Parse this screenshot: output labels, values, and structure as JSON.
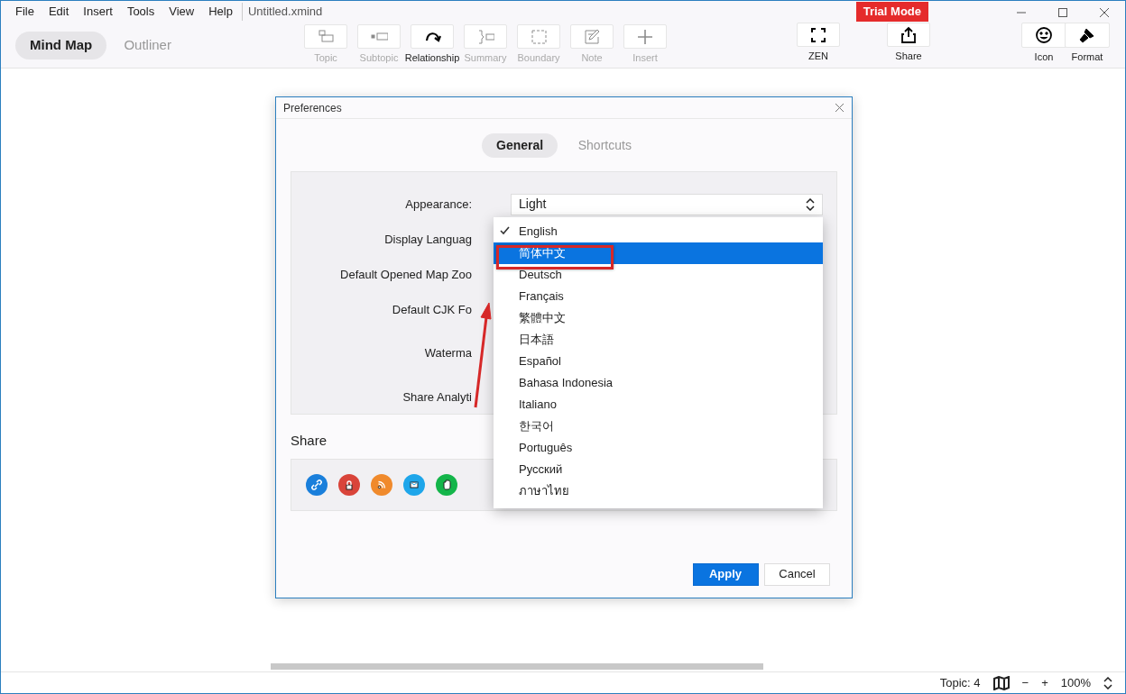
{
  "menu": [
    "File",
    "Edit",
    "Insert",
    "Tools",
    "View",
    "Help"
  ],
  "document_title": "Untitled.xmind",
  "trial_badge": "Trial Mode",
  "view_tabs": [
    {
      "label": "Mind Map",
      "selected": true
    },
    {
      "label": "Outliner",
      "selected": false
    }
  ],
  "tools": [
    {
      "kind": "topic",
      "label": "Topic",
      "disabled": true
    },
    {
      "kind": "subtopic",
      "label": "Subtopic",
      "disabled": true
    },
    {
      "kind": "relationship",
      "label": "Relationship",
      "disabled": false
    },
    {
      "kind": "summary",
      "label": "Summary",
      "disabled": true
    },
    {
      "kind": "boundary",
      "label": "Boundary",
      "disabled": true
    },
    {
      "kind": "note",
      "label": "Note",
      "disabled": true
    },
    {
      "kind": "insert",
      "label": "Insert",
      "disabled": true
    }
  ],
  "zen": {
    "label": "ZEN"
  },
  "share_button": {
    "label": "Share"
  },
  "panel_tools": [
    {
      "kind": "icon",
      "label": "Icon"
    },
    {
      "kind": "format",
      "label": "Format"
    }
  ],
  "dialog": {
    "title": "Preferences",
    "tabs": [
      {
        "label": "General",
        "selected": true
      },
      {
        "label": "Shortcuts",
        "selected": false
      }
    ],
    "settings": [
      {
        "label": "Appearance:",
        "value": "Light"
      },
      {
        "label": "Display Languag"
      },
      {
        "label": "Default Opened Map Zoo"
      },
      {
        "label": "Default CJK Fo"
      },
      {
        "label": "Waterma"
      },
      {
        "label": "Share Analyti"
      }
    ],
    "language_menu": [
      {
        "label": "English",
        "checked": true,
        "selected": false
      },
      {
        "label": "简体中文",
        "checked": false,
        "selected": true
      },
      {
        "label": "Deutsch",
        "checked": false,
        "selected": false
      },
      {
        "label": "Français",
        "checked": false,
        "selected": false
      },
      {
        "label": "繁體中文",
        "checked": false,
        "selected": false
      },
      {
        "label": "日本語",
        "checked": false,
        "selected": false
      },
      {
        "label": "Español",
        "checked": false,
        "selected": false
      },
      {
        "label": "Bahasa Indonesia",
        "checked": false,
        "selected": false
      },
      {
        "label": "Italiano",
        "checked": false,
        "selected": false
      },
      {
        "label": "한국어",
        "checked": false,
        "selected": false
      },
      {
        "label": "Português",
        "checked": false,
        "selected": false
      },
      {
        "label": "Русский",
        "checked": false,
        "selected": false
      },
      {
        "label": "ภาษาไทย",
        "checked": false,
        "selected": false
      }
    ],
    "share_heading": "Share",
    "share_targets": [
      {
        "kind": "link",
        "color": "#1a7fdb"
      },
      {
        "kind": "lock",
        "color": "#d9443a"
      },
      {
        "kind": "rss",
        "color": "#f08a2c"
      },
      {
        "kind": "mail",
        "color": "#1ea6ea"
      },
      {
        "kind": "evernote",
        "color": "#14b54a"
      }
    ],
    "buttons": [
      {
        "label": "Apply",
        "kind": "primary"
      },
      {
        "label": "Cancel",
        "kind": "secondary"
      }
    ]
  },
  "status_bar": {
    "topic_count": "Topic: 4",
    "zoom_out": "−",
    "zoom_in": "+",
    "zoom": "100%"
  }
}
